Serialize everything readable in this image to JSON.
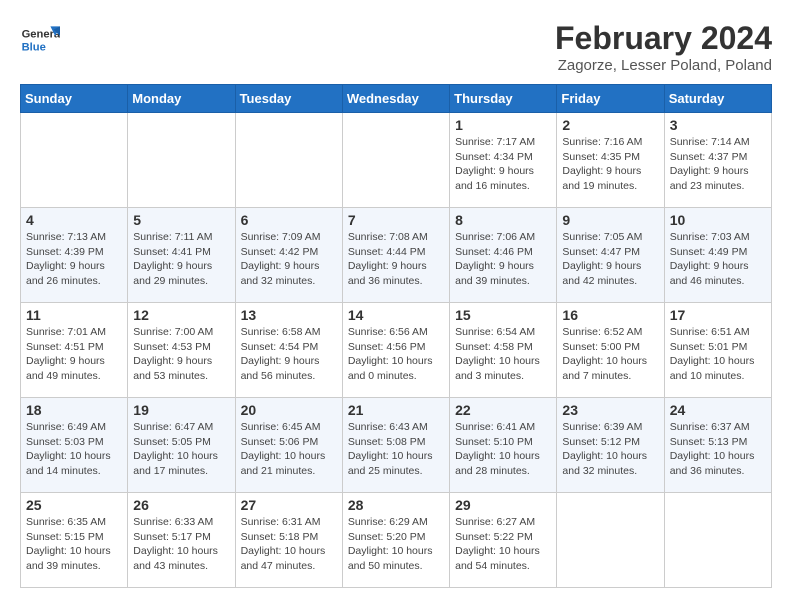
{
  "logo": {
    "line1": "General",
    "line2": "Blue"
  },
  "title": "February 2024",
  "subtitle": "Zagorze, Lesser Poland, Poland",
  "days_of_week": [
    "Sunday",
    "Monday",
    "Tuesday",
    "Wednesday",
    "Thursday",
    "Friday",
    "Saturday"
  ],
  "weeks": [
    [
      {
        "day": "",
        "info": ""
      },
      {
        "day": "",
        "info": ""
      },
      {
        "day": "",
        "info": ""
      },
      {
        "day": "",
        "info": ""
      },
      {
        "day": "1",
        "info": "Sunrise: 7:17 AM\nSunset: 4:34 PM\nDaylight: 9 hours\nand 16 minutes."
      },
      {
        "day": "2",
        "info": "Sunrise: 7:16 AM\nSunset: 4:35 PM\nDaylight: 9 hours\nand 19 minutes."
      },
      {
        "day": "3",
        "info": "Sunrise: 7:14 AM\nSunset: 4:37 PM\nDaylight: 9 hours\nand 23 minutes."
      }
    ],
    [
      {
        "day": "4",
        "info": "Sunrise: 7:13 AM\nSunset: 4:39 PM\nDaylight: 9 hours\nand 26 minutes."
      },
      {
        "day": "5",
        "info": "Sunrise: 7:11 AM\nSunset: 4:41 PM\nDaylight: 9 hours\nand 29 minutes."
      },
      {
        "day": "6",
        "info": "Sunrise: 7:09 AM\nSunset: 4:42 PM\nDaylight: 9 hours\nand 32 minutes."
      },
      {
        "day": "7",
        "info": "Sunrise: 7:08 AM\nSunset: 4:44 PM\nDaylight: 9 hours\nand 36 minutes."
      },
      {
        "day": "8",
        "info": "Sunrise: 7:06 AM\nSunset: 4:46 PM\nDaylight: 9 hours\nand 39 minutes."
      },
      {
        "day": "9",
        "info": "Sunrise: 7:05 AM\nSunset: 4:47 PM\nDaylight: 9 hours\nand 42 minutes."
      },
      {
        "day": "10",
        "info": "Sunrise: 7:03 AM\nSunset: 4:49 PM\nDaylight: 9 hours\nand 46 minutes."
      }
    ],
    [
      {
        "day": "11",
        "info": "Sunrise: 7:01 AM\nSunset: 4:51 PM\nDaylight: 9 hours\nand 49 minutes."
      },
      {
        "day": "12",
        "info": "Sunrise: 7:00 AM\nSunset: 4:53 PM\nDaylight: 9 hours\nand 53 minutes."
      },
      {
        "day": "13",
        "info": "Sunrise: 6:58 AM\nSunset: 4:54 PM\nDaylight: 9 hours\nand 56 minutes."
      },
      {
        "day": "14",
        "info": "Sunrise: 6:56 AM\nSunset: 4:56 PM\nDaylight: 10 hours\nand 0 minutes."
      },
      {
        "day": "15",
        "info": "Sunrise: 6:54 AM\nSunset: 4:58 PM\nDaylight: 10 hours\nand 3 minutes."
      },
      {
        "day": "16",
        "info": "Sunrise: 6:52 AM\nSunset: 5:00 PM\nDaylight: 10 hours\nand 7 minutes."
      },
      {
        "day": "17",
        "info": "Sunrise: 6:51 AM\nSunset: 5:01 PM\nDaylight: 10 hours\nand 10 minutes."
      }
    ],
    [
      {
        "day": "18",
        "info": "Sunrise: 6:49 AM\nSunset: 5:03 PM\nDaylight: 10 hours\nand 14 minutes."
      },
      {
        "day": "19",
        "info": "Sunrise: 6:47 AM\nSunset: 5:05 PM\nDaylight: 10 hours\nand 17 minutes."
      },
      {
        "day": "20",
        "info": "Sunrise: 6:45 AM\nSunset: 5:06 PM\nDaylight: 10 hours\nand 21 minutes."
      },
      {
        "day": "21",
        "info": "Sunrise: 6:43 AM\nSunset: 5:08 PM\nDaylight: 10 hours\nand 25 minutes."
      },
      {
        "day": "22",
        "info": "Sunrise: 6:41 AM\nSunset: 5:10 PM\nDaylight: 10 hours\nand 28 minutes."
      },
      {
        "day": "23",
        "info": "Sunrise: 6:39 AM\nSunset: 5:12 PM\nDaylight: 10 hours\nand 32 minutes."
      },
      {
        "day": "24",
        "info": "Sunrise: 6:37 AM\nSunset: 5:13 PM\nDaylight: 10 hours\nand 36 minutes."
      }
    ],
    [
      {
        "day": "25",
        "info": "Sunrise: 6:35 AM\nSunset: 5:15 PM\nDaylight: 10 hours\nand 39 minutes."
      },
      {
        "day": "26",
        "info": "Sunrise: 6:33 AM\nSunset: 5:17 PM\nDaylight: 10 hours\nand 43 minutes."
      },
      {
        "day": "27",
        "info": "Sunrise: 6:31 AM\nSunset: 5:18 PM\nDaylight: 10 hours\nand 47 minutes."
      },
      {
        "day": "28",
        "info": "Sunrise: 6:29 AM\nSunset: 5:20 PM\nDaylight: 10 hours\nand 50 minutes."
      },
      {
        "day": "29",
        "info": "Sunrise: 6:27 AM\nSunset: 5:22 PM\nDaylight: 10 hours\nand 54 minutes."
      },
      {
        "day": "",
        "info": ""
      },
      {
        "day": "",
        "info": ""
      }
    ]
  ]
}
